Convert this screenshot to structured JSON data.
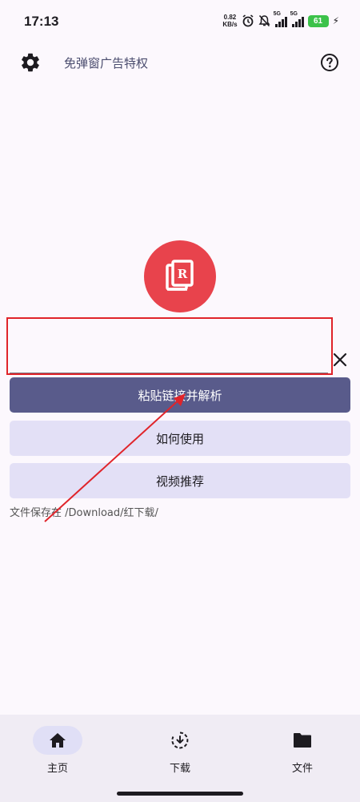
{
  "status_bar": {
    "time": "17:13",
    "net_speed_value": "0.82",
    "net_speed_unit": "KB/s",
    "sim1_label": "5G",
    "sim2_label": "5G",
    "battery_level": "61"
  },
  "top_bar": {
    "title": "免弹窗广告特权"
  },
  "main": {
    "url_input_value": "",
    "paste_button_label": "粘贴链接并解析",
    "howto_button_label": "如何使用",
    "video_button_label": "视频推荐",
    "save_path_text": "文件保存在 /Download/红下载/"
  },
  "bottom_nav": {
    "items": [
      {
        "label": "主页",
        "icon": "home-icon",
        "active": true
      },
      {
        "label": "下载",
        "icon": "download-icon",
        "active": false
      },
      {
        "label": "文件",
        "icon": "folder-icon",
        "active": false
      }
    ]
  },
  "colors": {
    "primary": "#595b8b",
    "secondary": "#e3e0f6",
    "logo": "#e8434c",
    "annotation_red": "#e0242a",
    "nav_background": "#f0ecf4"
  }
}
